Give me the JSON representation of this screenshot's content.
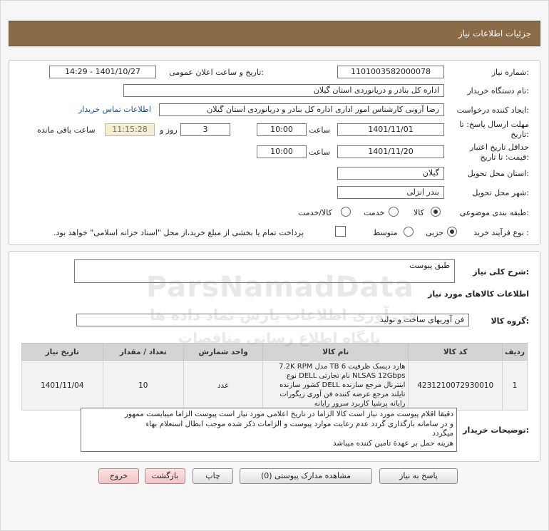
{
  "header": {
    "title": "جزئیات اطلاعات نیاز"
  },
  "fields": {
    "need_number_label": "شماره نیاز:",
    "need_number": "1101003582000078",
    "announce_label": "تاریخ و ساعت اعلان عمومی:",
    "announce_value": "1401/10/27 - 14:29",
    "buyer_label": "نام دستگاه خریدار:",
    "buyer_value": "اداره کل بنادر و دریانوردی استان گیلان",
    "creator_label": "ایجاد کننده درخواست:",
    "creator_value": "رضا آرونی کارشناس امور اداری اداره کل بنادر و دریانوردی استان گیلان",
    "contact_link": "اطلاعات تماس خریدار",
    "deadline_label_1": "مهلت ارسال پاسخ: تا",
    "deadline_label_2": "تاریخ:",
    "deadline_date": "1401/11/01",
    "time_label": "ساعت",
    "deadline_time": "10:00",
    "days_value": "3",
    "days_label": "روز و",
    "remaining_value": "11:15:28",
    "remaining_label": "ساعت باقی مانده",
    "validity_label_1": "حداقل تاریخ اعتبار",
    "validity_label_2": "قیمت: تا تاریخ:",
    "validity_date": "1401/11/20",
    "validity_time_label": "ساعت",
    "validity_time": "10:00",
    "province_label": "استان محل تحویل:",
    "province_value": "گیلان",
    "city_label": "شهر محل تحویل:",
    "city_value": "بندر انزلی",
    "category_label": "طبقه بندی موضوعی:",
    "category_options": [
      "کالا",
      "خدمت",
      "کالا/خدمت"
    ],
    "process_label": "نوع فرآیند خرید :",
    "process_options": [
      "جزیی",
      "متوسط"
    ],
    "payment_note": "پرداخت تمام یا بخشی از مبلغ خرید،از محل \"اسناد خزانه اسلامی\" خواهد بود."
  },
  "summary": {
    "label": "شرح کلی نیاز:",
    "value": "طبق پیوست",
    "items_title": "اطلاعات کالاهای مورد نیاز",
    "group_label": "گروه کالا:",
    "group_value": "فن آوریهای ساخت و تولید"
  },
  "table": {
    "headers": [
      "ردیف",
      "کد کالا",
      "نام کالا",
      "واحد شمارش",
      "تعداد / مقدار",
      "تاریخ نیاز"
    ],
    "rows": [
      {
        "index": "1",
        "code": "4231210072930010",
        "name": "هارد دیسک ظرفیت 6 TB مدل 7.2K RPM NLSAS 12Gbps نام تجارتی DELL نوع اینترنال مرجع سازنده DELL کشور سازنده تایلند مرجع عرضه کننده فن آوری زیگورات رایانه پرشیا کاربرد سرور رایانه",
        "unit": "عدد",
        "quantity": "10",
        "date": "1401/11/04"
      }
    ]
  },
  "buyer_notes": {
    "label": "توضیحات خریدار:",
    "lines": [
      "دقیقا اقلام پیوست مورد نیاز است کالا الزاما در تاریخ اعلامی مورد نیاز است پیوست الزاما میبایست ممهور",
      "و در سامانه بارگذاری گردد عدم رعایت موارد پیوست و الزامات ذکر شده موجب ابطال استعلام بهاء",
      "میگردد",
      "هزینه حمل بر عهدة تامین کننده میباشد"
    ]
  },
  "buttons": {
    "reply": "پاسخ به نیاز",
    "attachments": "مشاهده مدارک پیوستی (0)",
    "print": "چاپ",
    "back": "بازگشت",
    "exit": "خروج"
  },
  "watermark": {
    "brand": "ParsNamadData",
    "line1": "پایگاه اطلاع رسانی مناقصات",
    "line2": "فن آوری اطلاعات پارس نماد داده ها"
  }
}
